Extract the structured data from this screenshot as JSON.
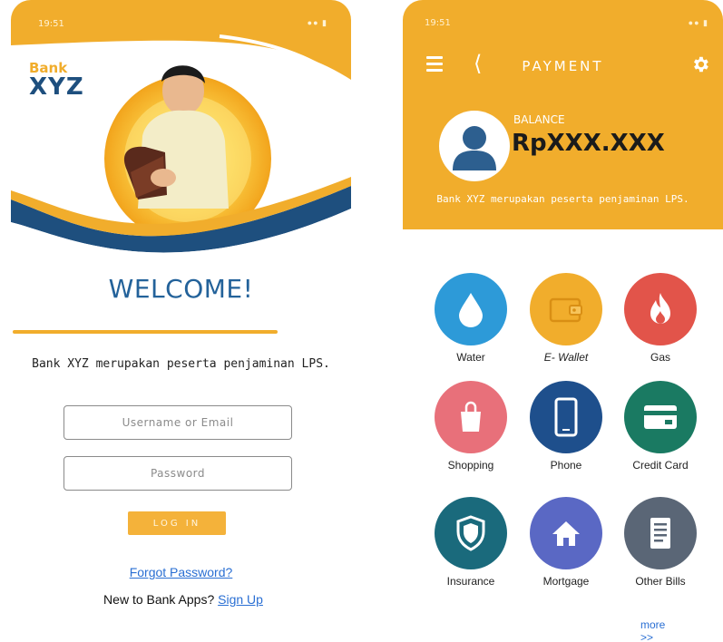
{
  "login": {
    "status_time": "19:51",
    "brand_small": "Bank",
    "brand_big": "XYZ",
    "welcome": "WELCOME!",
    "lps_text": "Bank XYZ merupakan peserta penjaminan LPS.",
    "username_placeholder": "Username or Email",
    "password_placeholder": "Password",
    "login_button": "LOG IN",
    "forgot_password": "Forgot Password?",
    "new_user_text": "New to Bank Apps?",
    "sign_up": "Sign Up"
  },
  "payment": {
    "status_time": "19:51",
    "title": "PAYMENT",
    "balance_label": "BALANCE",
    "balance_value": "RpXXX.XXX",
    "lps_text": "Bank XYZ merupakan peserta penjaminan LPS.",
    "services": [
      {
        "label": "Water",
        "color": "#2d9ad8",
        "icon": "water-drop-icon"
      },
      {
        "label": "E- Wallet",
        "color": "#f1ad2c",
        "icon": "wallet-icon"
      },
      {
        "label": "Gas",
        "color": "#e2544a",
        "icon": "flame-icon"
      },
      {
        "label": "Shopping",
        "color": "#e8707a",
        "icon": "shopping-bag-icon"
      },
      {
        "label": "Phone",
        "color": "#1e4f8c",
        "icon": "phone-icon"
      },
      {
        "label": "Credit  Card",
        "color": "#1a7a62",
        "icon": "credit-card-icon"
      },
      {
        "label": "Insurance",
        "color": "#1a6a7c",
        "icon": "shield-icon"
      },
      {
        "label": "Mortgage",
        "color": "#5a68c4",
        "icon": "home-icon"
      },
      {
        "label": "Other  Bills",
        "color": "#5a6676",
        "icon": "document-icon"
      }
    ],
    "more": "more",
    "more_arrows": ">>"
  },
  "colors": {
    "brand_orange": "#f1ad2c",
    "brand_blue": "#1e4f7e",
    "link_blue": "#2a6fd3"
  }
}
